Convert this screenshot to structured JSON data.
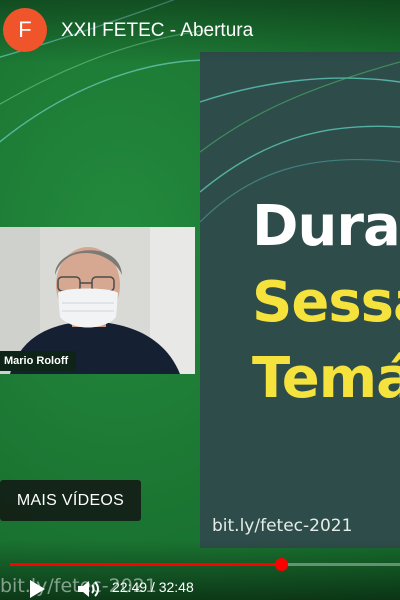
{
  "header": {
    "channel_initial": "F",
    "title": "XXII FETEC - Abertura"
  },
  "slide": {
    "lines": [
      "Duran",
      "Sessã",
      "Temá"
    ],
    "link": "bit.ly/fetec-2021"
  },
  "webcam": {
    "speaker_name": "Mario Roloff"
  },
  "overlay": {
    "more_videos": "MAIS VÍDEOS",
    "watermark": "bit.ly/fetec-2021"
  },
  "player": {
    "current_time": "22:49",
    "duration": "32:48",
    "time_display": "22:49 / 32:48",
    "progress_fraction": 0.696
  },
  "colors": {
    "background_green": "#1d7a35",
    "slide_bg": "#2e4d4a",
    "slide_highlight": "#f6e23c",
    "avatar": "#f0542a",
    "progress": "#ff0000"
  },
  "icons": {
    "play": "play-icon",
    "volume": "volume-icon"
  }
}
